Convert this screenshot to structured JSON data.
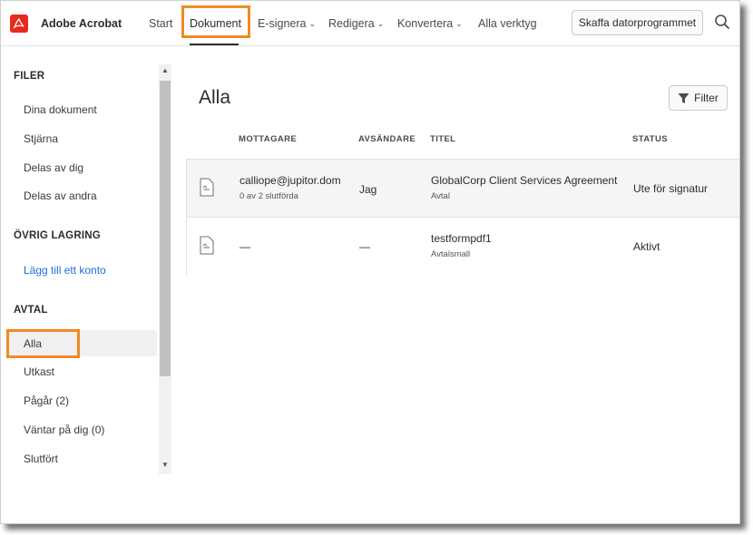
{
  "app": {
    "brand": "Adobe Acrobat",
    "accent": "#e62b1e",
    "highlight": "#f08a24"
  },
  "nav": {
    "items": [
      {
        "label": "Start"
      },
      {
        "label": "Dokument"
      },
      {
        "label": "E-signera",
        "chevron": "⌄"
      },
      {
        "label": "Redigera",
        "chevron": "⌄"
      },
      {
        "label": "Konvertera",
        "chevron": "⌄"
      },
      {
        "label": "Alla verktyg"
      }
    ],
    "active": "Dokument",
    "cta": "Skaffa datorprogrammet"
  },
  "sidebar": {
    "sections": [
      {
        "title": "FILER",
        "items": [
          "Dina dokument",
          "Stjärna",
          "Delas av dig",
          "Delas av andra"
        ]
      },
      {
        "title": "ÖVRIG LAGRING",
        "items": [
          "Lägg till ett konto"
        ]
      },
      {
        "title": "AVTAL",
        "items": [
          "Alla",
          "Utkast",
          "Pågår (2)",
          "Väntar på dig (0)",
          "Slutfört"
        ]
      }
    ],
    "selected": "Alla"
  },
  "main": {
    "title": "Alla",
    "filter_label": "Filter",
    "columns": [
      "MOTTAGARE",
      "AVSÄNDARE",
      "TITEL",
      "STATUS"
    ],
    "rows": [
      {
        "recipient": "calliope@jupitor.dom",
        "recipient_sub": "0 av 2 slutförda",
        "sender": "Jag",
        "title": "GlobalCorp Client Services Agreement",
        "title_sub": "Avtal",
        "status": "Ute för signatur"
      },
      {
        "recipient": "—",
        "recipient_sub": "",
        "sender": "—",
        "title": "testformpdf1",
        "title_sub": "Avtalsmall",
        "status": "Aktivt"
      }
    ]
  }
}
